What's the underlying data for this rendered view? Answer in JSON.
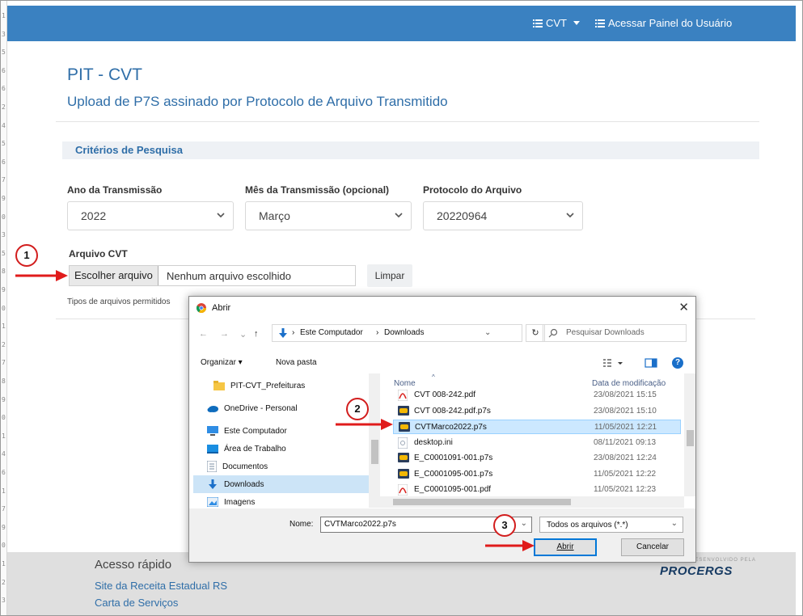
{
  "colors": {
    "brand_blue": "#3a81c1",
    "title_blue": "#2f6ea8",
    "annotation_red": "#d21d1d",
    "dialog_accent": "#0078d7"
  },
  "gutter": {
    "numbers": [
      "1",
      "3",
      "5",
      "6",
      "6",
      "2",
      "4",
      "5",
      "6",
      "7",
      "9",
      "0",
      "3",
      "5",
      "8",
      "9",
      "0",
      "1",
      "2",
      "7",
      "8",
      "9",
      "0",
      "1",
      "4",
      "6",
      "1",
      "7",
      "9",
      "0",
      "1",
      "2",
      "3"
    ]
  },
  "topbar": {
    "menu_cvt": "CVT",
    "menu_panel": "Acessar Painel do Usuário",
    "menu_icon": "list-icon",
    "dropdown_icon": "caret-down-icon"
  },
  "page": {
    "title": "PIT - CVT",
    "subtitle": "Upload de P7S assinado por Protocolo de Arquivo Transmitido"
  },
  "criteria": {
    "header": "Critérios de Pesquisa",
    "year": {
      "label": "Ano da Transmissão",
      "value": "2022"
    },
    "month": {
      "label": "Mês da Transmissão (opcional)",
      "value": "Março"
    },
    "protocol": {
      "label": "Protocolo do Arquivo",
      "value": "20220964"
    }
  },
  "upload": {
    "label": "Arquivo CVT",
    "choose_button": "Escolher arquivo",
    "no_file": "Nenhum arquivo escolhido",
    "clear_button": "Limpar",
    "allowed_types": "Tipos de arquivos permitidos"
  },
  "footer": {
    "title": "Acesso rápido",
    "links": [
      "Site da Receita Estadual RS",
      "Carta de Serviços"
    ],
    "brand_small": "DESENVOLVIDO PELA",
    "brand": "PROCERGS"
  },
  "annotations": [
    "1",
    "2",
    "3"
  ],
  "dialog": {
    "title": "Abrir",
    "close": "✕",
    "breadcrumb": [
      "Este Computador",
      "Downloads"
    ],
    "search_placeholder": "Pesquisar Downloads",
    "organize": "Organizar ▾",
    "new_folder": "Nova pasta",
    "help": "?",
    "nav_items": [
      {
        "label": "PIT-CVT_Prefeituras",
        "icon": "folder-icon"
      },
      {
        "label": "OneDrive - Personal",
        "icon": "cloud-icon"
      },
      {
        "label": "Este Computador",
        "icon": "computer-icon"
      },
      {
        "label": "Área de Trabalho",
        "icon": "desktop-icon"
      },
      {
        "label": "Documentos",
        "icon": "document-icon"
      },
      {
        "label": "Downloads",
        "icon": "download-icon"
      },
      {
        "label": "Imagens",
        "icon": "image-icon"
      }
    ],
    "columns": {
      "name": "Nome",
      "date": "Data de modificação"
    },
    "files": [
      {
        "name": "CVT 008-242.pdf",
        "date": "23/08/2021 15:15",
        "icon": "pdf-icon"
      },
      {
        "name": "CVT 008-242.pdf.p7s",
        "date": "23/08/2021 15:10",
        "icon": "p7s-icon"
      },
      {
        "name": "CVTMarco2022.p7s",
        "date": "11/05/2021 12:21",
        "icon": "p7s-icon",
        "selected": true
      },
      {
        "name": "desktop.ini",
        "date": "08/11/2021 09:13",
        "icon": "ini-icon"
      },
      {
        "name": "E_C0001091-001.p7s",
        "date": "23/08/2021 12:24",
        "icon": "p7s-icon"
      },
      {
        "name": "E_C0001095-001.p7s",
        "date": "11/05/2021 12:22",
        "icon": "p7s-icon"
      },
      {
        "name": "E_C0001095-001.pdf",
        "date": "11/05/2021 12:23",
        "icon": "pdf-icon"
      }
    ],
    "name_label": "Nome:",
    "name_value": "CVTMarco2022.p7s",
    "filter": "Todos os arquivos (*.*)",
    "open_button": "Abrir",
    "cancel_button": "Cancelar"
  }
}
